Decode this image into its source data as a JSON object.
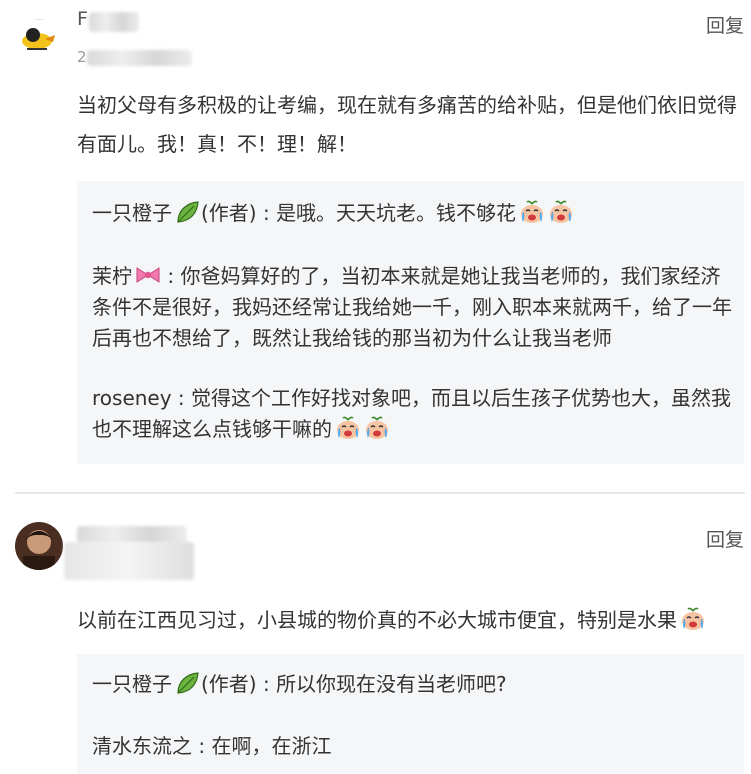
{
  "comments": [
    {
      "author_name": "F",
      "date_prefix": "2",
      "reply_label": "回复",
      "text": "当初父母有多积极的让考编，现在就有多痛苦的给补贴，但是他们依旧觉得有面儿。我！真！不！理！解！",
      "replies": [
        {
          "author": "一只橙子",
          "badge": "(作者)",
          "sep": " : ",
          "text": "是哦。天天坑老。钱不够花"
        },
        {
          "author": "茉柠",
          "badge": "",
          "sep": " : ",
          "text": "你爸妈算好的了，当初本来就是她让我当老师的，我们家经济条件不是很好，我妈还经常让我给她一千，刚入职本来就两千，给了一年后再也不想给了，既然让我给钱的那当初为什么让我当老师"
        },
        {
          "author": "roseney",
          "badge": "",
          "sep": " : ",
          "text": "觉得这个工作好找对象吧，而且以后生孩子优势也大，虽然我也不理解这么点钱够干嘛的"
        }
      ]
    },
    {
      "author_name": "",
      "date_prefix": "",
      "reply_label": "回复",
      "text": "以前在江西见习过，小县城的物价真的不必大城市便宜，特别是水果",
      "replies": [
        {
          "author": "一只橙子",
          "badge": "(作者)",
          "sep": " : ",
          "text": "所以你现在没有当老师吧?"
        },
        {
          "author": "清水东流之",
          "badge": "",
          "sep": " : ",
          "text": "在啊，在浙江"
        }
      ]
    }
  ],
  "icons": {
    "leaf": "leaf-icon",
    "bow": "bow-icon",
    "crying_face": "crying-face-icon"
  },
  "colors": {
    "thread_bg": "#f4f6f8",
    "divider": "#e8e8e8",
    "text": "#333333",
    "reply_link": "#555555"
  }
}
